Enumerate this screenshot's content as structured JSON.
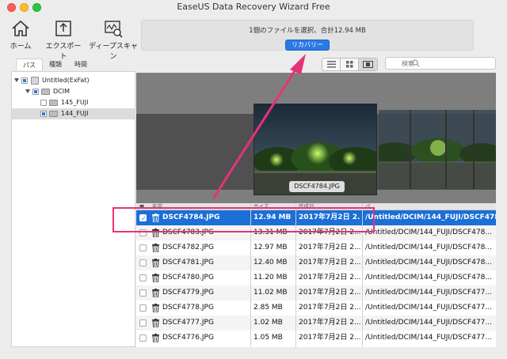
{
  "window": {
    "title": "EaseUS Data Recovery Wizard Free"
  },
  "toolbar": {
    "home_label": "ホーム",
    "export_label": "エクスポート",
    "deep_scan_label": "ディープスキャン"
  },
  "status": {
    "text": "1個のファイルを選択、合計12.94 MB",
    "recover_label": "リカバリー"
  },
  "tabs": [
    {
      "label": "パス",
      "active": true
    },
    {
      "label": "種類",
      "active": false
    },
    {
      "label": "時間",
      "active": false
    }
  ],
  "search": {
    "placeholder": "検索"
  },
  "tree": {
    "drive": "Untitled(ExFat)",
    "dcim": "DCIM",
    "folder1": "145_FUJI",
    "folder2": "144_FUJI"
  },
  "preview": {
    "caption": "DSCF4784.JPG"
  },
  "table": {
    "headers": {
      "name": "名前",
      "size": "サイズ",
      "date": "作成日",
      "path": "パ"
    },
    "rows": [
      {
        "name": "DSCF4784.JPG",
        "size": "12.94 MB",
        "date": "2017年7月2日 2...",
        "path": "/Untitled/DCIM/144_FUJI/DSCF478...",
        "checked": true
      },
      {
        "name": "DSCF4783.JPG",
        "size": "13.31 MB",
        "date": "2017年7月2日 2...",
        "path": "/Untitled/DCIM/144_FUJI/DSCF478...",
        "checked": false
      },
      {
        "name": "DSCF4782.JPG",
        "size": "12.97 MB",
        "date": "2017年7月2日 2...",
        "path": "/Untitled/DCIM/144_FUJI/DSCF478...",
        "checked": false
      },
      {
        "name": "DSCF4781.JPG",
        "size": "12.40 MB",
        "date": "2017年7月2日 2...",
        "path": "/Untitled/DCIM/144_FUJI/DSCF478...",
        "checked": false
      },
      {
        "name": "DSCF4780.JPG",
        "size": "11.20 MB",
        "date": "2017年7月2日 2...",
        "path": "/Untitled/DCIM/144_FUJI/DSCF478...",
        "checked": false
      },
      {
        "name": "DSCF4779.JPG",
        "size": "11.02 MB",
        "date": "2017年7月2日 2...",
        "path": "/Untitled/DCIM/144_FUJI/DSCF477...",
        "checked": false
      },
      {
        "name": "DSCF4778.JPG",
        "size": "2.85 MB",
        "date": "2017年7月2日 2...",
        "path": "/Untitled/DCIM/144_FUJI/DSCF477...",
        "checked": false
      },
      {
        "name": "DSCF4777.JPG",
        "size": "1.02 MB",
        "date": "2017年7月2日 2...",
        "path": "/Untitled/DCIM/144_FUJI/DSCF477...",
        "checked": false
      },
      {
        "name": "DSCF4776.JPG",
        "size": "1.05 MB",
        "date": "2017年7月2日 2...",
        "path": "/Untitled/DCIM/144_FUJI/DSCF477...",
        "checked": false
      }
    ]
  },
  "colors": {
    "accent": "#1b6fd6",
    "annotation": "#e8317a"
  }
}
